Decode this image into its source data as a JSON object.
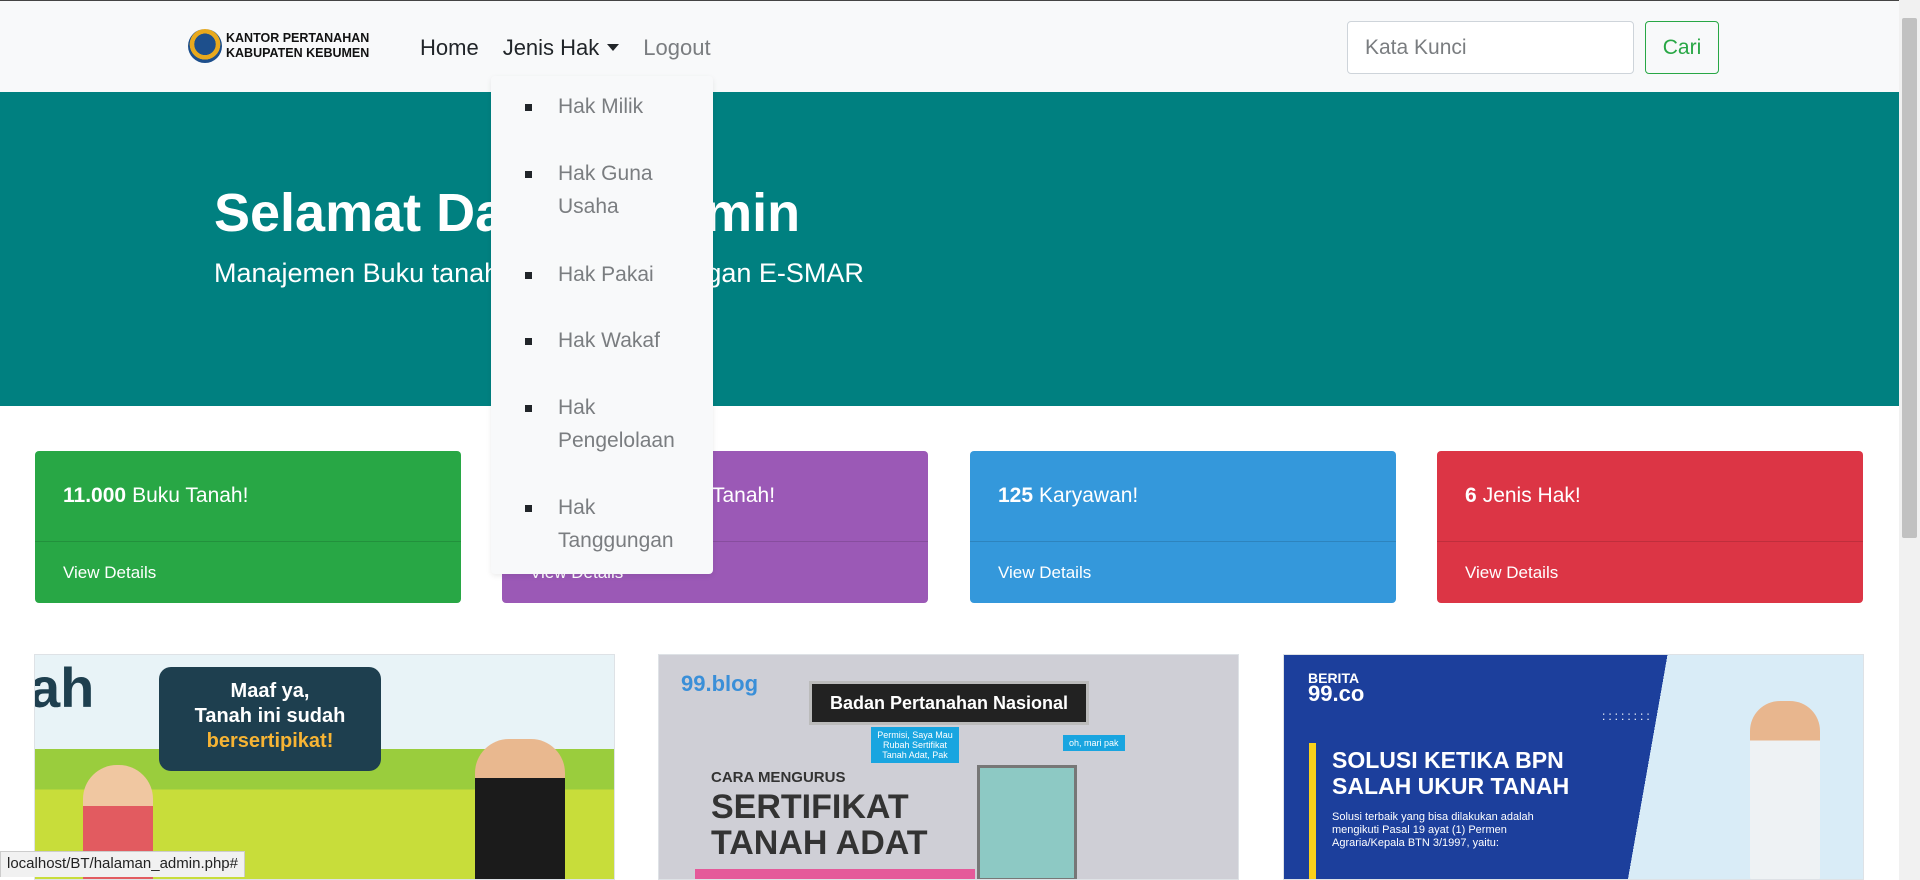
{
  "navbar": {
    "brand_line1": "KANTOR PERTANAHAN",
    "brand_line2": "KABUPATEN KEBUMEN",
    "links": {
      "home": "Home",
      "jenis_hak": "Jenis Hak",
      "logout": "Logout"
    },
    "search": {
      "placeholder": "Kata Kunci",
      "value": "",
      "button": "Cari"
    }
  },
  "dropdown": {
    "items": [
      "Hak Milik",
      "Hak Guna Usaha",
      "Hak Pakai",
      "Hak Wakaf",
      "Hak Pengelolaan",
      "Hak Tanggungan"
    ]
  },
  "hero": {
    "title": "Selamat Datang Admin",
    "subtitle": "Manajemen Buku tanah lebih mudah dengan E-SMAR"
  },
  "cards": [
    {
      "count": "11.000",
      "label": "Buku Tanah!",
      "footer": "View Details",
      "color": "#28a745"
    },
    {
      "count": "",
      "label": "Tanah!",
      "footer": "View Details",
      "color": "#9b59b6"
    },
    {
      "count": "125",
      "label": "Karyawan!",
      "footer": "View Details",
      "color": "#3498db"
    },
    {
      "count": "6",
      "label": "Jenis Hak!",
      "footer": "View Details",
      "color": "#dc3545"
    }
  ],
  "images": {
    "img1": {
      "big": "ah",
      "bubble_l1": "Maaf ya,",
      "bubble_l2": "Tanah ini sudah",
      "bubble_l3": "bersertipikat!"
    },
    "img2": {
      "blog": "99.blog",
      "banner": "Badan Pertanahan Nasional",
      "tag1": "Permisi, Saya Mau Rubah Sertifikat Tanah Adat, Pak",
      "tag2": "oh, mari pak",
      "cara": "CARA MENGURUS",
      "sert1": "SERTIFIKAT",
      "sert2": "TANAH ADAT"
    },
    "img3": {
      "brand_top": "BERITA",
      "brand_num": "99.co",
      "headline1": "SOLUSI KETIKA BPN",
      "headline2": "SALAH UKUR TANAH",
      "small": "Solusi terbaik yang bisa dilakukan adalah mengikuti Pasal 19 ayat (1) Permen Agraria/Kepala BTN 3/1997, yaitu:",
      "dots": "::::::::"
    }
  },
  "status_url": "localhost/BT/halaman_admin.php#"
}
